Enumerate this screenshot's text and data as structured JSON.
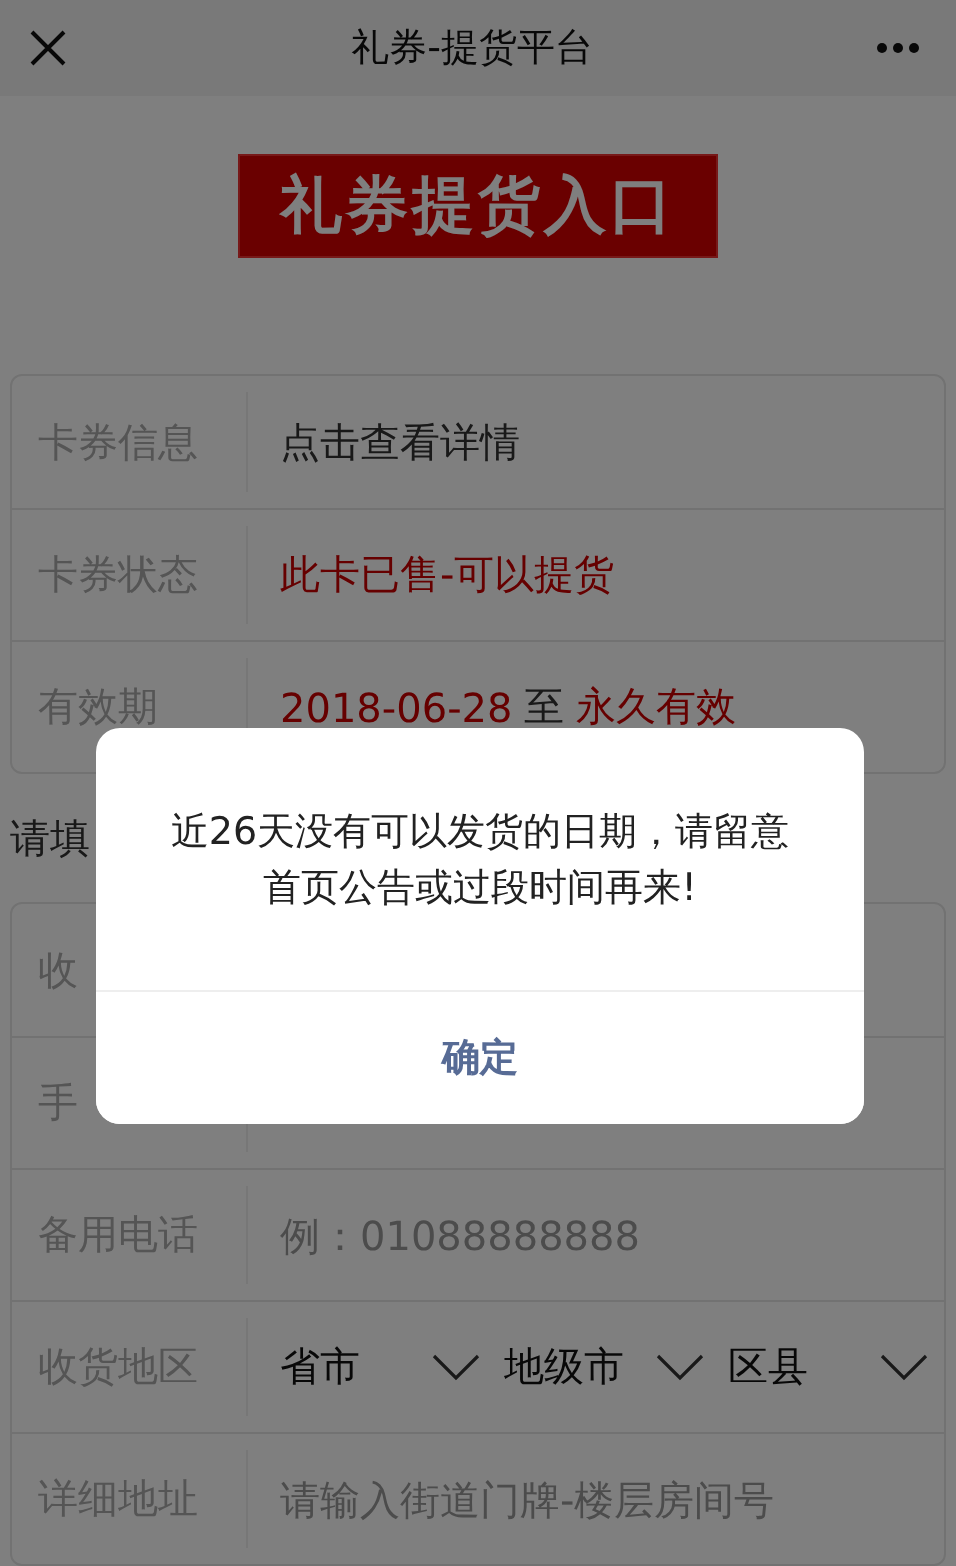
{
  "window": {
    "title": "礼券-提货平台"
  },
  "banner": {
    "text": "礼券提货入口"
  },
  "info_card": {
    "rows": [
      {
        "label": "卡券信息",
        "segments": [
          {
            "text": "点击查看详情",
            "kind": "plain"
          }
        ]
      },
      {
        "label": "卡券状态",
        "segments": [
          {
            "text": "此卡已售-可以提货",
            "kind": "red"
          }
        ]
      },
      {
        "label": "有效期",
        "segments": [
          {
            "text": "2018-06-28",
            "kind": "red"
          },
          {
            "text": "至",
            "kind": "plain"
          },
          {
            "text": "永久有效",
            "kind": "red"
          }
        ]
      }
    ]
  },
  "section_title": "请填",
  "form": {
    "rows": [
      {
        "label": "收",
        "kind": "text"
      },
      {
        "label": "手",
        "kind": "text"
      },
      {
        "label": "备用电话",
        "kind": "input",
        "placeholder": "例：01088888888"
      },
      {
        "label": "收货地区",
        "kind": "selects",
        "selects": [
          "省市",
          "地级市",
          "区县"
        ]
      },
      {
        "label": "详细地址",
        "kind": "input",
        "placeholder": "请输入街道门牌-楼层房间号"
      }
    ]
  },
  "dialog": {
    "message": "近26天没有可以发货的日期，请留意首页公告或过段时间再来!",
    "button": "确定"
  }
}
